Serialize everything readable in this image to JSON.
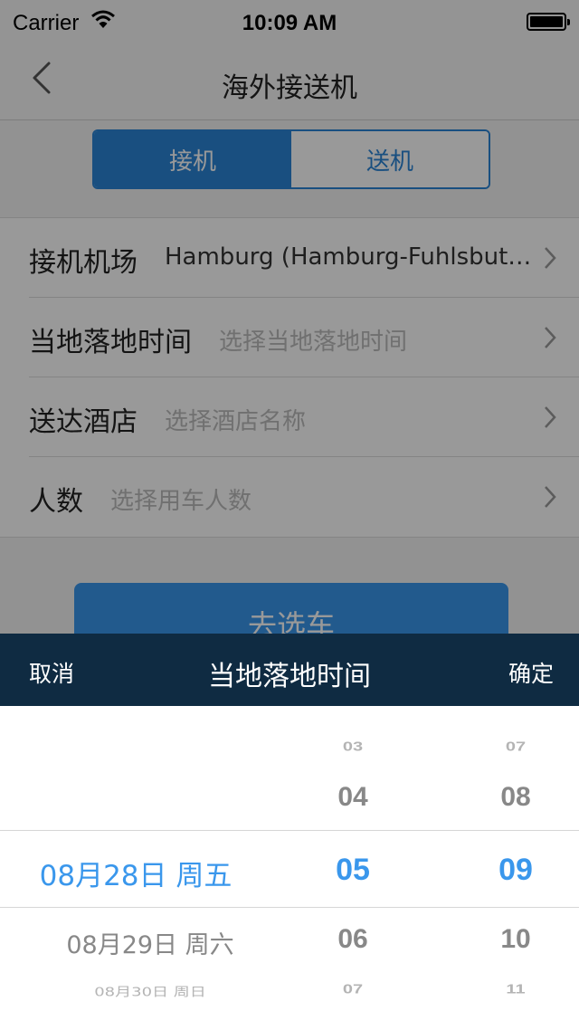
{
  "status": {
    "carrier": "Carrier",
    "time": "10:09 AM"
  },
  "nav": {
    "title": "海外接送机"
  },
  "segment": {
    "pickup": "接机",
    "dropoff": "送机",
    "active": "pickup"
  },
  "form": {
    "airport_label": "接机机场",
    "airport_value": "Hamburg (Hamburg-Fuhlsbuttel)",
    "landing_label": "当地落地时间",
    "landing_placeholder": "选择当地落地时间",
    "hotel_label": "送达酒店",
    "hotel_placeholder": "选择酒店名称",
    "people_label": "人数",
    "people_placeholder": "选择用车人数"
  },
  "go_button": "去选车",
  "picker_toolbar": {
    "cancel": "取消",
    "title": "当地落地时间",
    "confirm": "确定"
  },
  "picker": {
    "date_column": {
      "selected": "08月28日  周五",
      "below1": "08月29日  周六",
      "below2": "08月30日  周日"
    },
    "hour_column": {
      "above2": "03",
      "above1": "04",
      "selected": "05",
      "below1": "06",
      "below2": "07"
    },
    "minute_column": {
      "above2": "07",
      "above1": "08",
      "selected": "09",
      "below1": "10",
      "below2": "11"
    }
  },
  "colors": {
    "accent": "#2a84d6",
    "toolbar": "#0f2b42",
    "selected_text": "#3a97ec"
  }
}
